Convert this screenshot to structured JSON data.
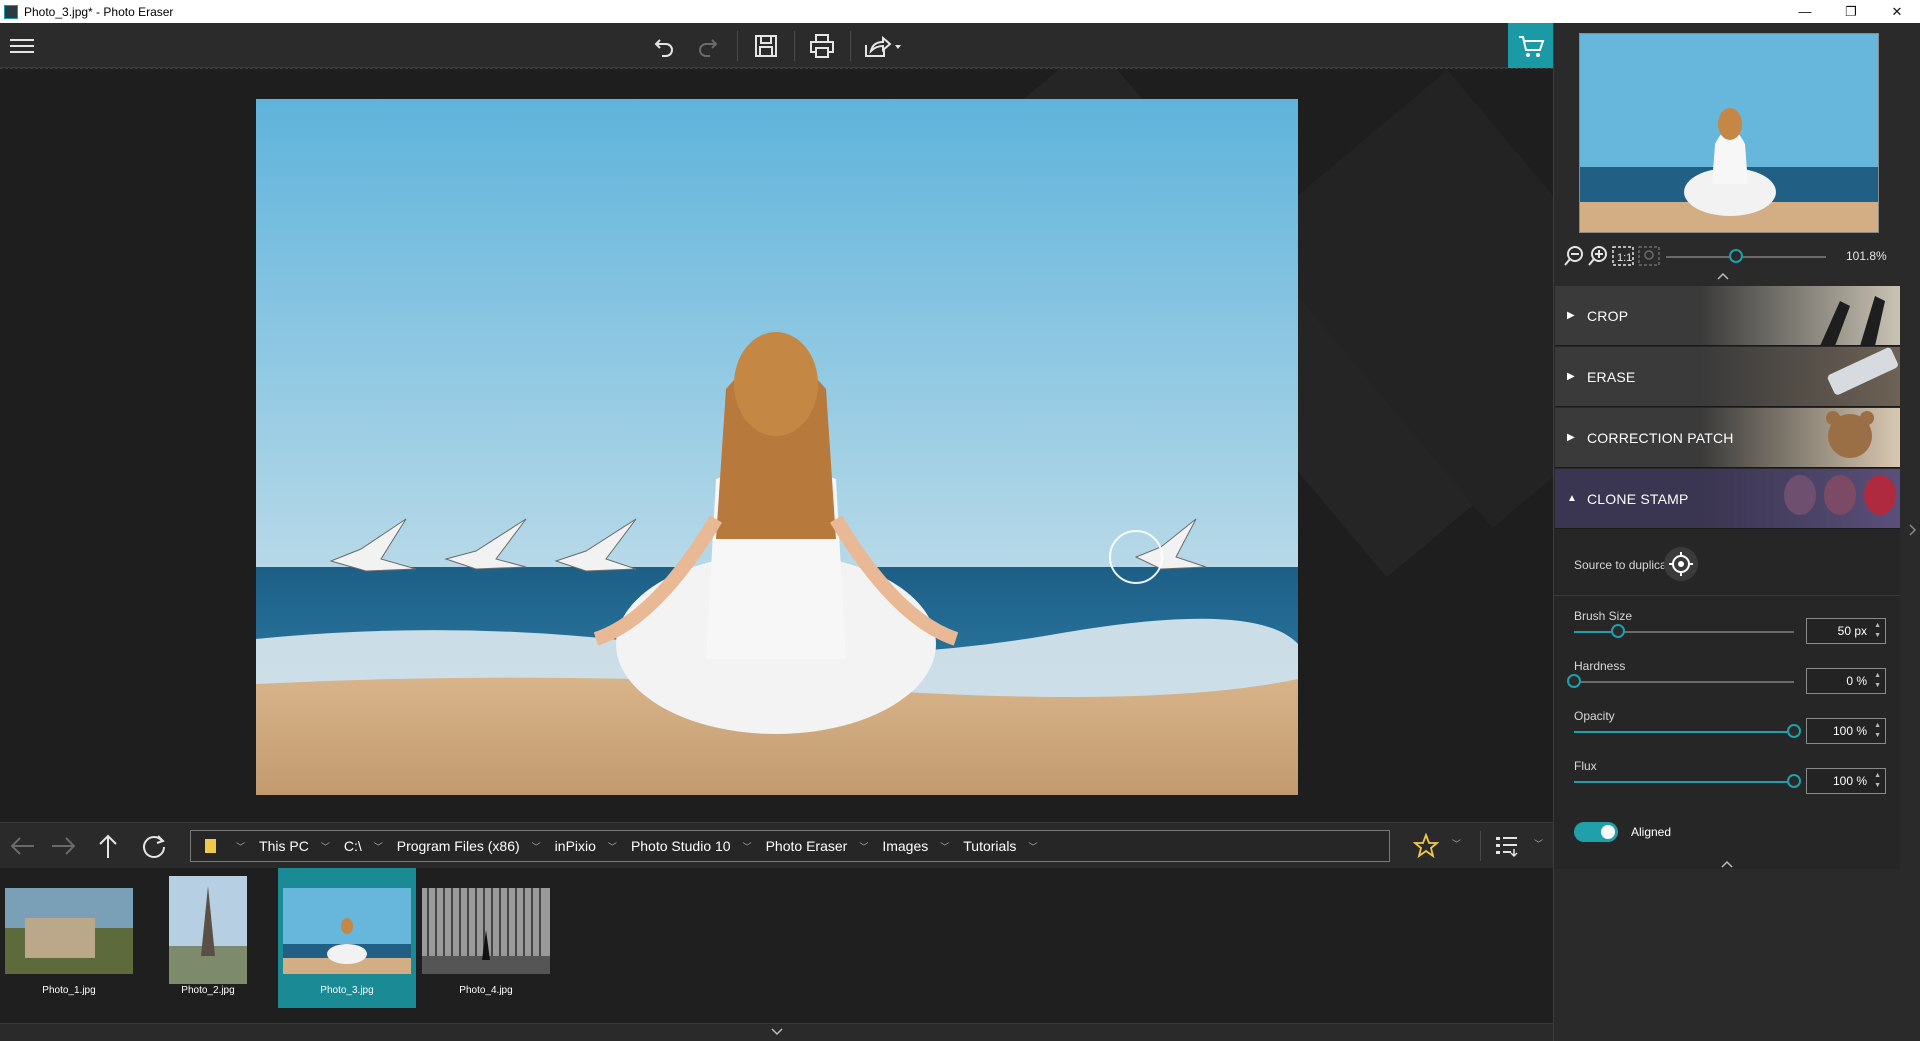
{
  "window": {
    "title": "Photo_3.jpg* - Photo Eraser",
    "minimize": "—",
    "maximize": "❐",
    "close": "✕"
  },
  "toolbar": {
    "menu_icon": "hamburger-icon",
    "undo_icon": "undo-icon",
    "redo_icon": "redo-icon",
    "save_icon": "save-icon",
    "print_icon": "print-icon",
    "share_icon": "share-icon",
    "cart_icon": "cart-icon"
  },
  "accent": "#1b9aa5",
  "zoom": {
    "value": "101.8%",
    "level": 0.44
  },
  "tools": [
    {
      "label": "CROP",
      "expanded": false
    },
    {
      "label": "ERASE",
      "expanded": false
    },
    {
      "label": "CORRECTION PATCH",
      "expanded": false
    },
    {
      "label": "CLONE STAMP",
      "expanded": true
    }
  ],
  "clone_stamp": {
    "source_label": "Source to duplicate",
    "brush_size": {
      "label": "Brush Size",
      "value": "50 px",
      "level": 0.2
    },
    "hardness": {
      "label": "Hardness",
      "value": "0 %",
      "level": 0.0
    },
    "opacity": {
      "label": "Opacity",
      "value": "100 %",
      "level": 1.0
    },
    "flux": {
      "label": "Flux",
      "value": "100 %",
      "level": 1.0
    },
    "aligned": {
      "label": "Aligned",
      "on": true
    }
  },
  "path": [
    "This PC",
    "C:\\",
    "Program Files (x86)",
    "inPixio",
    "Photo Studio 10",
    "Photo Eraser",
    "Images",
    "Tutorials"
  ],
  "files": [
    {
      "name": "Photo_1.jpg",
      "selected": false
    },
    {
      "name": "Photo_2.jpg",
      "selected": false
    },
    {
      "name": "Photo_3.jpg",
      "selected": true
    },
    {
      "name": "Photo_4.jpg",
      "selected": false
    }
  ]
}
